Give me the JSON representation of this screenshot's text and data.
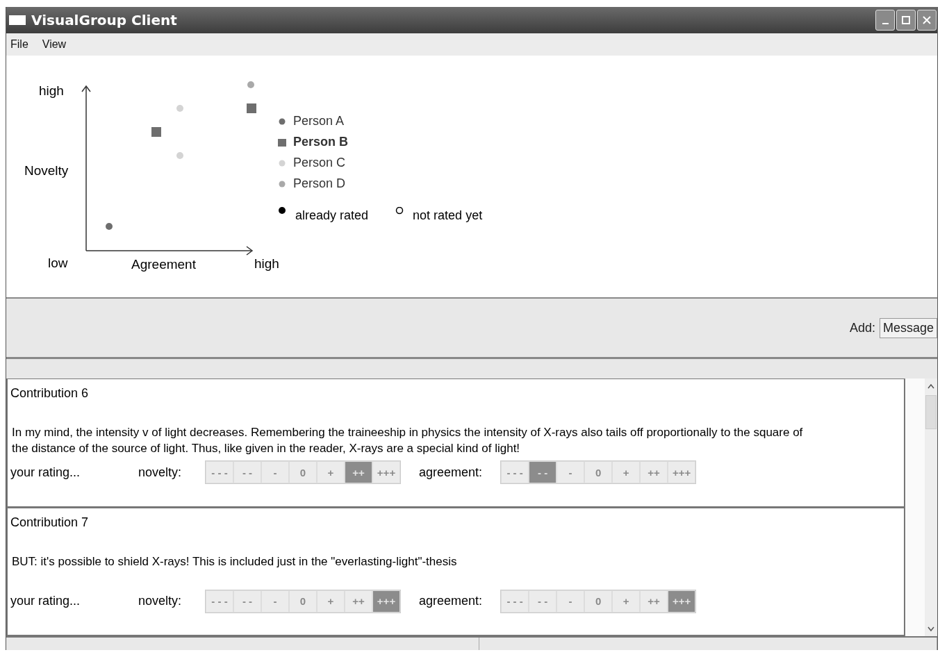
{
  "window": {
    "title": "VisualGroup Client"
  },
  "menu": [
    {
      "label": "File"
    },
    {
      "label": "View"
    }
  ],
  "plot": {
    "y_high": "high",
    "y_label": "Novelty",
    "origin": "low",
    "x_label": "Agreement",
    "x_high": "high",
    "persons": [
      {
        "name": "Person A",
        "kind": "circle",
        "color": "#6e6e6e",
        "selected": false
      },
      {
        "name": "Person B",
        "kind": "square",
        "color": "#6e6e6e",
        "selected": true
      },
      {
        "name": "Person C",
        "kind": "circle",
        "color": "#d4d4d4",
        "selected": false
      },
      {
        "name": "Person D",
        "kind": "circle",
        "color": "#a9a9a9",
        "selected": false
      }
    ],
    "status_legend": [
      {
        "label": "already rated",
        "kind": "filled"
      },
      {
        "label": "not rated yet",
        "kind": "hollow"
      }
    ]
  },
  "add_bar": {
    "label": "Add:",
    "button": "Message"
  },
  "contributions": [
    {
      "title": "Contribution 6",
      "text": "In my mind, the intensity v of light decreases. Remembering the traineeship in physics the intensity of X-rays also tails off proportionally to the square of the distance of the source of light. Thus, like given in the reader, X-rays are a special kind of light!",
      "rating_label": "your rating...",
      "scales": [
        {
          "label": "novelty:",
          "options": [
            {
              "label": "- - -",
              "selected": false
            },
            {
              "label": "- -",
              "selected": false
            },
            {
              "label": "-",
              "selected": false
            },
            {
              "label": "0",
              "selected": false
            },
            {
              "label": "+",
              "selected": false
            },
            {
              "label": "++",
              "selected": true
            },
            {
              "label": "+++",
              "selected": false
            }
          ]
        },
        {
          "label": "agreement:",
          "options": [
            {
              "label": "- - -",
              "selected": false
            },
            {
              "label": "- -",
              "selected": true
            },
            {
              "label": "-",
              "selected": false
            },
            {
              "label": "0",
              "selected": false
            },
            {
              "label": "+",
              "selected": false
            },
            {
              "label": "++",
              "selected": false
            },
            {
              "label": "+++",
              "selected": false
            }
          ]
        }
      ]
    },
    {
      "title": "Contribution 7",
      "text": "BUT: it's possible to shield X-rays! This is included just in the \"everlasting-light\"-thesis",
      "rating_label": "your rating...",
      "scales": [
        {
          "label": "novelty:",
          "options": [
            {
              "label": "- - -",
              "selected": false
            },
            {
              "label": "- -",
              "selected": false
            },
            {
              "label": "-",
              "selected": false
            },
            {
              "label": "0",
              "selected": false
            },
            {
              "label": "+",
              "selected": false
            },
            {
              "label": "++",
              "selected": false
            },
            {
              "label": "+++",
              "selected": true
            }
          ]
        },
        {
          "label": "agreement:",
          "options": [
            {
              "label": "- - -",
              "selected": false
            },
            {
              "label": "- -",
              "selected": false
            },
            {
              "label": "-",
              "selected": false
            },
            {
              "label": "0",
              "selected": false
            },
            {
              "label": "+",
              "selected": false
            },
            {
              "label": "++",
              "selected": false
            },
            {
              "label": "+++",
              "selected": true
            }
          ]
        }
      ]
    }
  ]
}
